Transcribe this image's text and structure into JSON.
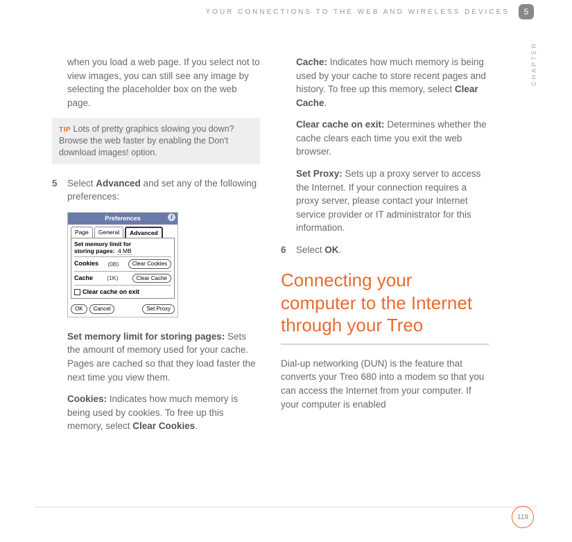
{
  "header": {
    "running_title": "YOUR CONNECTIONS TO THE WEB AND WIRELESS DEVICES",
    "chapter_number": "5",
    "chapter_label": "CHAPTER"
  },
  "col1": {
    "lead_paragraph": "when you load a web page. If you select not to view images, you can still see any image by selecting the placeholder box on the web page.",
    "tip_label": "TIP",
    "tip_text": " Lots of pretty graphics slowing you down? Browse the web faster by enabling the Don't download images! option.",
    "step5_num": "5",
    "step5_lead_a": "Select ",
    "step5_lead_bold": "Advanced",
    "step5_lead_b": " and set any of the following preferences:",
    "mem_heading": "Set memory limit for storing pages:",
    "mem_text": " Sets the amount of memory used for your cache. Pages are cached so that they load faster the next time you view them.",
    "cookies_heading": "Cookies:",
    "cookies_text_a": " Indicates how much memory is being used by cookies. To free up this memory, select ",
    "cookies_bold": "Clear Cookies",
    "cookies_text_b": "."
  },
  "prefs": {
    "title": "Preferences",
    "tab_page": "Page",
    "tab_general": "General",
    "tab_advanced": "Advanced",
    "memlimit_label_a": "Set memory limit for",
    "memlimit_label_b": "storing pages:",
    "memlimit_value": "4 MB",
    "cookies_label": "Cookies",
    "cookies_size": "(0B)",
    "clear_cookies_btn": "Clear Cookies",
    "cache_label": "Cache",
    "cache_size": "(1K)",
    "clear_cache_btn": "Clear Cache",
    "clear_on_exit": "Clear cache on exit",
    "ok_btn": "OK",
    "cancel_btn": "Cancel",
    "setproxy_btn": "Set Proxy"
  },
  "col2": {
    "cache_heading": "Cache:",
    "cache_text_a": " Indicates how much memory is being used by your cache to store recent pages and history. To free up this memory, select ",
    "cache_bold": "Clear Cache",
    "cache_text_b": ".",
    "clearexit_heading": "Clear cache on exit:",
    "clearexit_text": " Determines whether the cache clears each time you exit the web browser.",
    "setproxy_heading": "Set Proxy:",
    "setproxy_text": " Sets up a proxy server to access the Internet. If your connection requires a proxy server, please contact your Internet service provider or IT administrator for this information.",
    "step6_num": "6",
    "step6_lead": "Select ",
    "step6_bold": "OK",
    "step6_tail": ".",
    "section_heading": "Connecting your computer to the Internet through your Treo",
    "section_body": "Dial-up networking (DUN) is the feature that converts your Treo 680 into a modem so that you can access the Internet from your computer. If your computer is enabled"
  },
  "footer": {
    "page_number": "119"
  }
}
